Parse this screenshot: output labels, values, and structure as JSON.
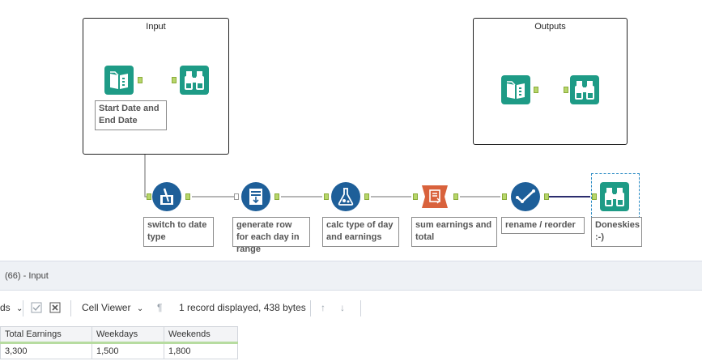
{
  "containers": {
    "input": {
      "title": "Input"
    },
    "outputs": {
      "title": "Outputs"
    }
  },
  "annotations": {
    "start_end": "Start Date and End Date",
    "switch_date": "switch to date type",
    "generate_rows": "generate row for each day in range",
    "calc_type": "calc type of day and earnings",
    "sum_earnings": "sum earnings and total",
    "rename": "rename / reorder",
    "doneskies": "Doneskies :-)"
  },
  "icons": {
    "input_book": "text-input-book-icon",
    "browse": "browse-binoculars-icon",
    "select": "select-tool-icon",
    "generate": "generate-rows-icon",
    "formula": "formula-flask-icon",
    "summarize": "summarize-icon",
    "check": "select-check-icon"
  },
  "colors": {
    "teal": "#1e9b86",
    "blue": "#1e5f99",
    "orange": "#d9623c",
    "anchor": "#b7d66a",
    "connector": "#8c8c8c",
    "connector_selected": "#2b2d6e"
  },
  "results": {
    "title": "(66) - Input",
    "toolbar": {
      "fields_fragment": "ds",
      "viewer": "Cell Viewer",
      "status": "1 record displayed, 438 bytes"
    },
    "columns": [
      "Total Earnings",
      "Weekdays",
      "Weekends"
    ],
    "rows": [
      [
        "3,300",
        "1,500",
        "1,800"
      ]
    ]
  }
}
